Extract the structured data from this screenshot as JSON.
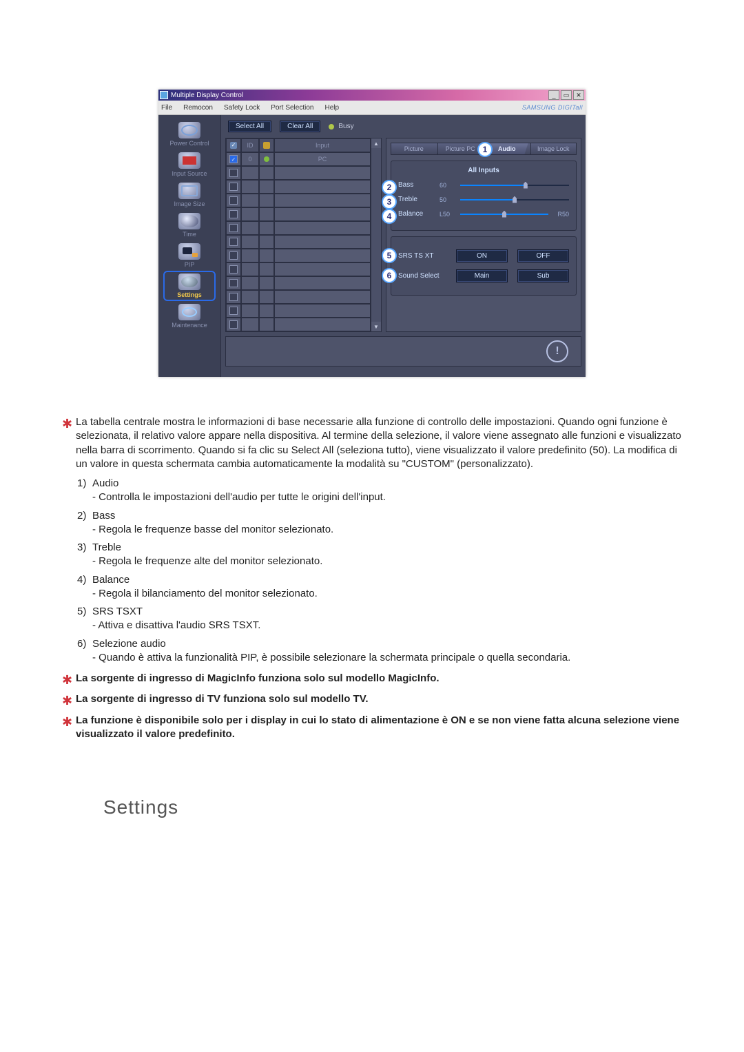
{
  "app": {
    "title": "Multiple Display Control",
    "brand": "SAMSUNG DIGITall",
    "menu": {
      "file": "File",
      "remocon": "Remocon",
      "safety": "Safety Lock",
      "port": "Port Selection",
      "help": "Help"
    },
    "window": {
      "min": "_",
      "max": "▭",
      "close": "✕"
    }
  },
  "sidebar": {
    "items": [
      {
        "label": "Power Control"
      },
      {
        "label": "Input Source"
      },
      {
        "label": "Image Size"
      },
      {
        "label": "Time"
      },
      {
        "label": "PIP"
      },
      {
        "label": "Settings"
      },
      {
        "label": "Maintenance"
      }
    ]
  },
  "toolbar": {
    "select_all": "Select All",
    "clear_all": "Clear All",
    "busy": "Busy"
  },
  "grid": {
    "headers": {
      "id": "ID",
      "input": "Input"
    },
    "row0": {
      "id": "0",
      "input": "PC"
    }
  },
  "tabs": {
    "picture": "Picture",
    "picture_pc": "Picture PC",
    "audio": "Audio",
    "image_lock": "Image Lock"
  },
  "audio_panel": {
    "title": "All Inputs",
    "bass": {
      "label": "Bass",
      "value": "60"
    },
    "treble": {
      "label": "Treble",
      "value": "50"
    },
    "balance": {
      "label": "Balance",
      "left": "L50",
      "right": "R50"
    },
    "srs": {
      "label": "SRS TS XT",
      "on": "ON",
      "off": "OFF"
    },
    "sound_select": {
      "label": "Sound Select",
      "main": "Main",
      "sub": "Sub"
    }
  },
  "callouts": {
    "c1": "1",
    "c2": "2",
    "c3": "3",
    "c4": "4",
    "c5": "5",
    "c6": "6"
  },
  "desc": {
    "intro": "La tabella centrale mostra le informazioni di base necessarie alla funzione di controllo delle impostazioni. Quando ogni funzione è selezionata, il relativo valore appare nella dispositiva. Al termine della selezione, il valore viene assegnato alle funzioni e visualizzato nella barra di scorrimento. Quando si fa clic su Select All (seleziona tutto), viene visualizzato il valore predefinito (50). La modifica di un valore in questa schermata cambia automaticamente la modalità su \"CUSTOM\" (personalizzato).",
    "items": [
      {
        "n": "1)",
        "t": "Audio",
        "s": "- Controlla le impostazioni dell'audio per tutte le origini dell'input."
      },
      {
        "n": "2)",
        "t": "Bass",
        "s": "- Regola le frequenze basse del monitor selezionato."
      },
      {
        "n": "3)",
        "t": "Treble",
        "s": "- Regola le frequenze alte del monitor selezionato."
      },
      {
        "n": "4)",
        "t": "Balance",
        "s": "- Regola il bilanciamento del monitor selezionato."
      },
      {
        "n": "5)",
        "t": "SRS TSXT",
        "s": "- Attiva e disattiva l'audio SRS TSXT."
      },
      {
        "n": "6)",
        "t": "Selezione audio",
        "s": "- Quando è attiva la funzionalità PIP, è possibile selezionare la schermata principale o quella secondaria."
      }
    ],
    "notes": [
      "La sorgente di ingresso di MagicInfo funziona solo sul modello MagicInfo.",
      "La sorgente di ingresso di TV funziona solo sul modello TV.",
      "La funzione è disponibile solo per i display in cui lo stato di alimentazione è ON e se non viene fatta alcuna selezione viene visualizzato il valore predefinito."
    ]
  },
  "section_title": "Settings"
}
